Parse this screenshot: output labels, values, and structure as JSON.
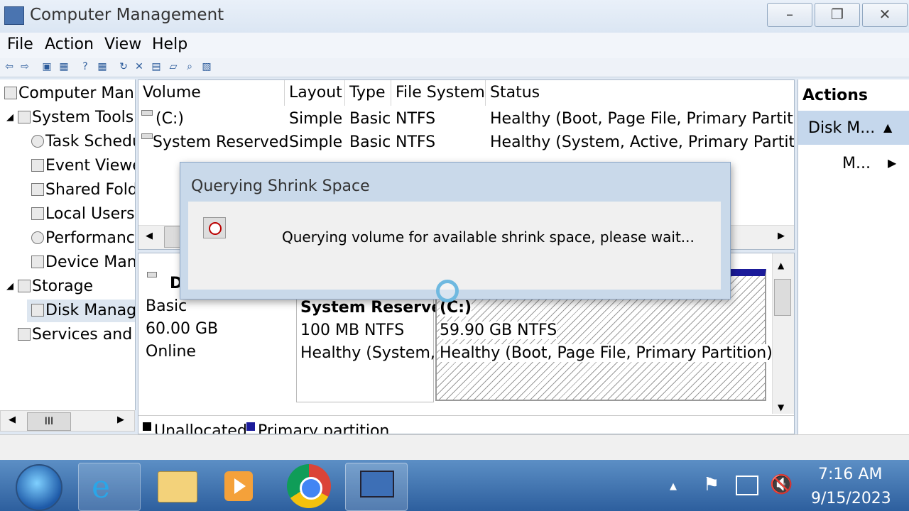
{
  "window": {
    "title": "Computer Management",
    "minimize": "–",
    "maximize": "❐",
    "close": "✕"
  },
  "menu": [
    "File",
    "Action",
    "View",
    "Help"
  ],
  "tree": {
    "root": "Computer Man",
    "system_tools": "System Tools",
    "task_scheduler": "Task Schedu",
    "event_viewer": "Event Viewe",
    "shared_folders": "Shared Fold",
    "local_users": "Local Users",
    "performance": "Performanc",
    "device_manager": "Device Man",
    "storage": "Storage",
    "disk_management": "Disk Manag",
    "services": "Services and A",
    "scroll_mid": "III"
  },
  "volume_list": {
    "headers": [
      "Volume",
      "Layout",
      "Type",
      "File System",
      "Status"
    ],
    "rows": [
      [
        "(C:)",
        "Simple",
        "Basic",
        "NTFS",
        "Healthy (Boot, Page File, Primary Partitio"
      ],
      [
        "System Reserved",
        "Simple",
        "Basic",
        "NTFS",
        "Healthy (System, Active, Primary Partitior"
      ]
    ]
  },
  "disk": {
    "label": "D",
    "type": "Basic",
    "size": "60.00 GB",
    "status": "Online",
    "partitions": [
      {
        "name": "System Reserve",
        "size": "100 MB NTFS",
        "status": "Healthy (System,"
      },
      {
        "name": "(C:)",
        "size": "59.90 GB NTFS",
        "status": "Healthy (Boot, Page File, Primary Partition)"
      }
    ],
    "legend": [
      "Unallocated",
      "Primary partition"
    ]
  },
  "actions": {
    "title": "Actions",
    "group": "Disk M...",
    "more": "M..."
  },
  "dialog": {
    "title": "Querying Shrink Space",
    "message": "Querying volume for available shrink space, please wait..."
  },
  "taskbar": {
    "time": "7:16 AM",
    "date": "9/15/2023"
  }
}
